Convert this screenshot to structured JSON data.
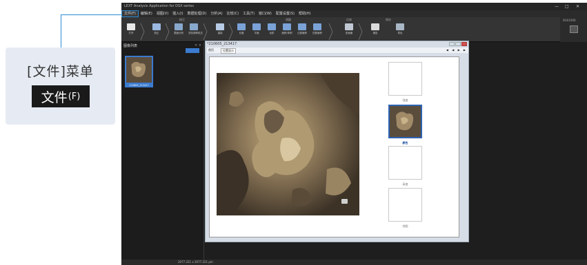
{
  "callout": {
    "title": "[文件]菜单",
    "chip_label": "文件",
    "chip_key": "(F)"
  },
  "app": {
    "title": "LEXT Analysis Application for DSX series",
    "window_controls": [
      "—",
      "□",
      "✕"
    ]
  },
  "menu": [
    {
      "label": "文件(F)",
      "active": true
    },
    {
      "label": "编辑(E)"
    },
    {
      "label": "视图(V)"
    },
    {
      "label": "插入(I)"
    },
    {
      "label": "数据处理(D)"
    },
    {
      "label": "分析(A)"
    },
    {
      "label": "比较(C)"
    },
    {
      "label": "工具(T)"
    },
    {
      "label": "窗口(W)"
    },
    {
      "label": "配置设置(S)"
    },
    {
      "label": "帮助(H)"
    }
  ],
  "ribbon": {
    "groups": [
      "校正",
      "测量",
      "比较",
      "保存"
    ],
    "buttons": [
      "打开",
      "校正",
      "表面分析",
      "去除倾斜校正",
      "渲染",
      "长度",
      "平面",
      "台阶",
      "面积/体积",
      "凸部面积",
      "凹部面积",
      "多画面",
      "报告",
      "导出"
    ],
    "right_label": "DSX1000",
    "right_button_icon": "dsx-logo-icon"
  },
  "sidebar": {
    "title": "图像列表",
    "controls": "× ×",
    "thumb_caption": "21060S_213417"
  },
  "document": {
    "title": "*210605_213417",
    "toolbar_first": "首页",
    "toolbar_select": "位置显示",
    "nav": "◀ ◀ ▶ ▶",
    "modes": [
      {
        "label": "强度",
        "selected": false
      },
      {
        "label": "颜色",
        "selected": true
      },
      {
        "label": "高度",
        "selected": false
      },
      {
        "label": "地图",
        "selected": false
      }
    ]
  },
  "status": {
    "text": "2077.221 x 2077.221 μm"
  },
  "colors": {
    "accent": "#2a8cd6",
    "selection": "#3b7bd0",
    "app_bg": "#1e1e1e"
  }
}
